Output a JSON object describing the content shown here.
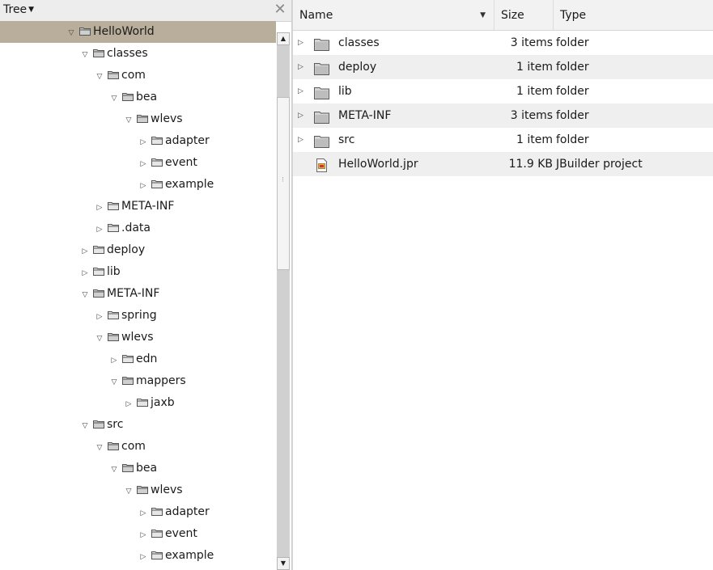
{
  "tree_panel": {
    "title": "Tree",
    "nodes": [
      {
        "label": "HelloWorld",
        "depth": 0,
        "expanded": true,
        "selected": true
      },
      {
        "label": "classes",
        "depth": 0,
        "expanded": true
      },
      {
        "label": "com",
        "depth": 1,
        "expanded": true
      },
      {
        "label": "bea",
        "depth": 2,
        "expanded": true
      },
      {
        "label": "wlevs",
        "depth": 3,
        "expanded": true
      },
      {
        "label": "adapter",
        "depth": 4,
        "expanded": false
      },
      {
        "label": "event",
        "depth": 4,
        "expanded": false
      },
      {
        "label": "example",
        "depth": 4,
        "expanded": false
      },
      {
        "label": "META-INF",
        "depth": 1,
        "expanded": false
      },
      {
        "label": ".data",
        "depth": 1,
        "expanded": false
      },
      {
        "label": "deploy",
        "depth": 0,
        "expanded": false
      },
      {
        "label": "lib",
        "depth": 0,
        "expanded": false
      },
      {
        "label": "META-INF",
        "depth": 0,
        "expanded": true
      },
      {
        "label": "spring",
        "depth": 1,
        "expanded": false
      },
      {
        "label": "wlevs",
        "depth": 1,
        "expanded": true
      },
      {
        "label": "edn",
        "depth": 2,
        "expanded": false
      },
      {
        "label": "mappers",
        "depth": 2,
        "expanded": true
      },
      {
        "label": "jaxb",
        "depth": 3,
        "expanded": false
      },
      {
        "label": "src",
        "depth": 0,
        "expanded": true
      },
      {
        "label": "com",
        "depth": 1,
        "expanded": true
      },
      {
        "label": "bea",
        "depth": 2,
        "expanded": true
      },
      {
        "label": "wlevs",
        "depth": 3,
        "expanded": true
      },
      {
        "label": "adapter",
        "depth": 4,
        "expanded": false
      },
      {
        "label": "event",
        "depth": 4,
        "expanded": false
      },
      {
        "label": "example",
        "depth": 4,
        "expanded": false
      }
    ]
  },
  "file_list": {
    "columns": {
      "name": "Name",
      "size": "Size",
      "type": "Type"
    },
    "rows": [
      {
        "name": "classes",
        "size": "3 items",
        "type": "folder",
        "kind": "folder"
      },
      {
        "name": "deploy",
        "size": "1 item",
        "type": "folder",
        "kind": "folder"
      },
      {
        "name": "lib",
        "size": "1 item",
        "type": "folder",
        "kind": "folder"
      },
      {
        "name": "META-INF",
        "size": "3 items",
        "type": "folder",
        "kind": "folder"
      },
      {
        "name": "src",
        "size": "1 item",
        "type": "folder",
        "kind": "folder"
      },
      {
        "name": "HelloWorld.jpr",
        "size": "11.9 KB",
        "type": "JBuilder project",
        "kind": "file"
      }
    ]
  },
  "icons": {
    "tree_title_caret": "caret-down-icon",
    "close": "close-icon",
    "expander_open": "triangle-down-icon",
    "expander_closed": "triangle-right-icon",
    "folder": "folder-icon",
    "file": "document-icon",
    "sort": "sort-desc-icon"
  },
  "colors": {
    "selected_row": "#b9ae9b",
    "alt_row": "#efefef",
    "header_bg": "#f2f2f2",
    "scrollbar_track": "#d0d0d0"
  }
}
